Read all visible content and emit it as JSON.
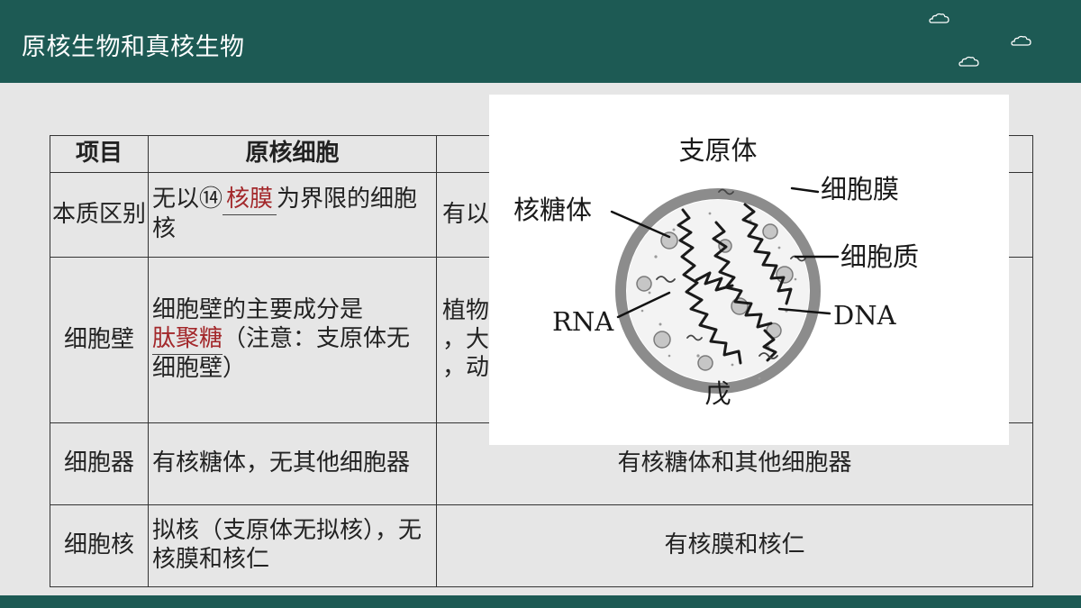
{
  "slide": {
    "title": "原核生物和真核生物"
  },
  "table": {
    "headers": [
      "项目",
      "原核细胞",
      ""
    ],
    "rows": {
      "essence": {
        "label": "本质区别",
        "prokaryote_prefix": "无以⑭",
        "prokaryote_blank": "核膜",
        "prokaryote_suffix": "为界限的细胞核",
        "eukaryote": "有以"
      },
      "wall": {
        "label": "细胞壁",
        "prokaryote_line1": "细胞壁的主要成分是",
        "prokaryote_blank": "肽聚糖",
        "prokaryote_rest": "（注意：支原体无细胞壁）",
        "eukaryote_line1": "植物",
        "eukaryote_line2": "，大",
        "eukaryote_line3": "，动"
      },
      "organelle": {
        "label": "细胞器",
        "prokaryote": "有核糖体，无其他细胞器",
        "eukaryote": "有核糖体和其他细胞器"
      },
      "nucleus": {
        "label": "细胞核",
        "prokaryote": "拟核（支原体无拟核），无核膜和核仁",
        "eukaryote": "有核膜和核仁"
      }
    }
  },
  "figure": {
    "title": "支原体",
    "caption": "戊",
    "labels": {
      "membrane": "细胞膜",
      "ribosome": "核糖体",
      "cytoplasm": "细胞质",
      "rna": "RNA",
      "dna": "DNA"
    }
  }
}
